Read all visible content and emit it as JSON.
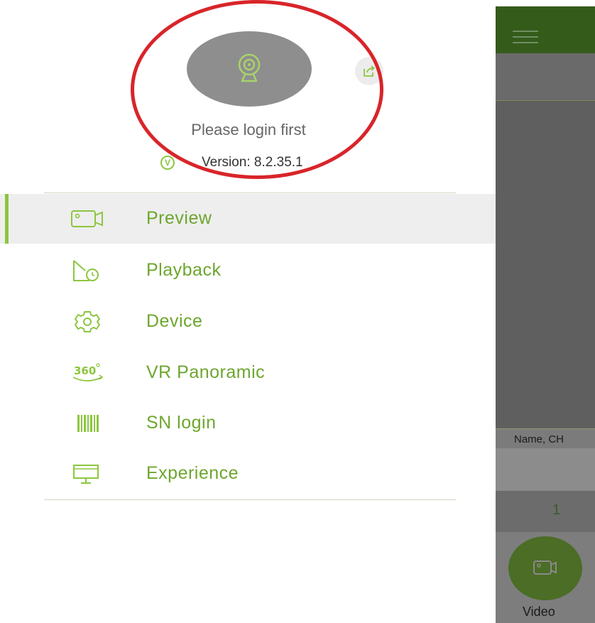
{
  "drawer": {
    "login_prompt": "Please login first",
    "version_label": "Version: 8.2.35.1",
    "version_icon": "V",
    "menu": [
      {
        "label": "Preview",
        "icon": "camera-icon",
        "active": true
      },
      {
        "label": "Playback",
        "icon": "playback-clock-icon",
        "active": false
      },
      {
        "label": "Device",
        "icon": "gear-icon",
        "active": false
      },
      {
        "label": "VR Panoramic",
        "icon": "panorama-360-icon",
        "active": false
      },
      {
        "label": "SN login",
        "icon": "barcode-icon",
        "active": false
      },
      {
        "label": "Experience",
        "icon": "monitor-icon",
        "active": false
      }
    ]
  },
  "background_app": {
    "tab_label": "Name, CH",
    "page_number": "1",
    "video_button_label": "Video"
  },
  "colors": {
    "accent": "#8cc63f",
    "menu_text": "#6da62e",
    "annotation": "#d8252a",
    "topbar": "#355b1b"
  }
}
